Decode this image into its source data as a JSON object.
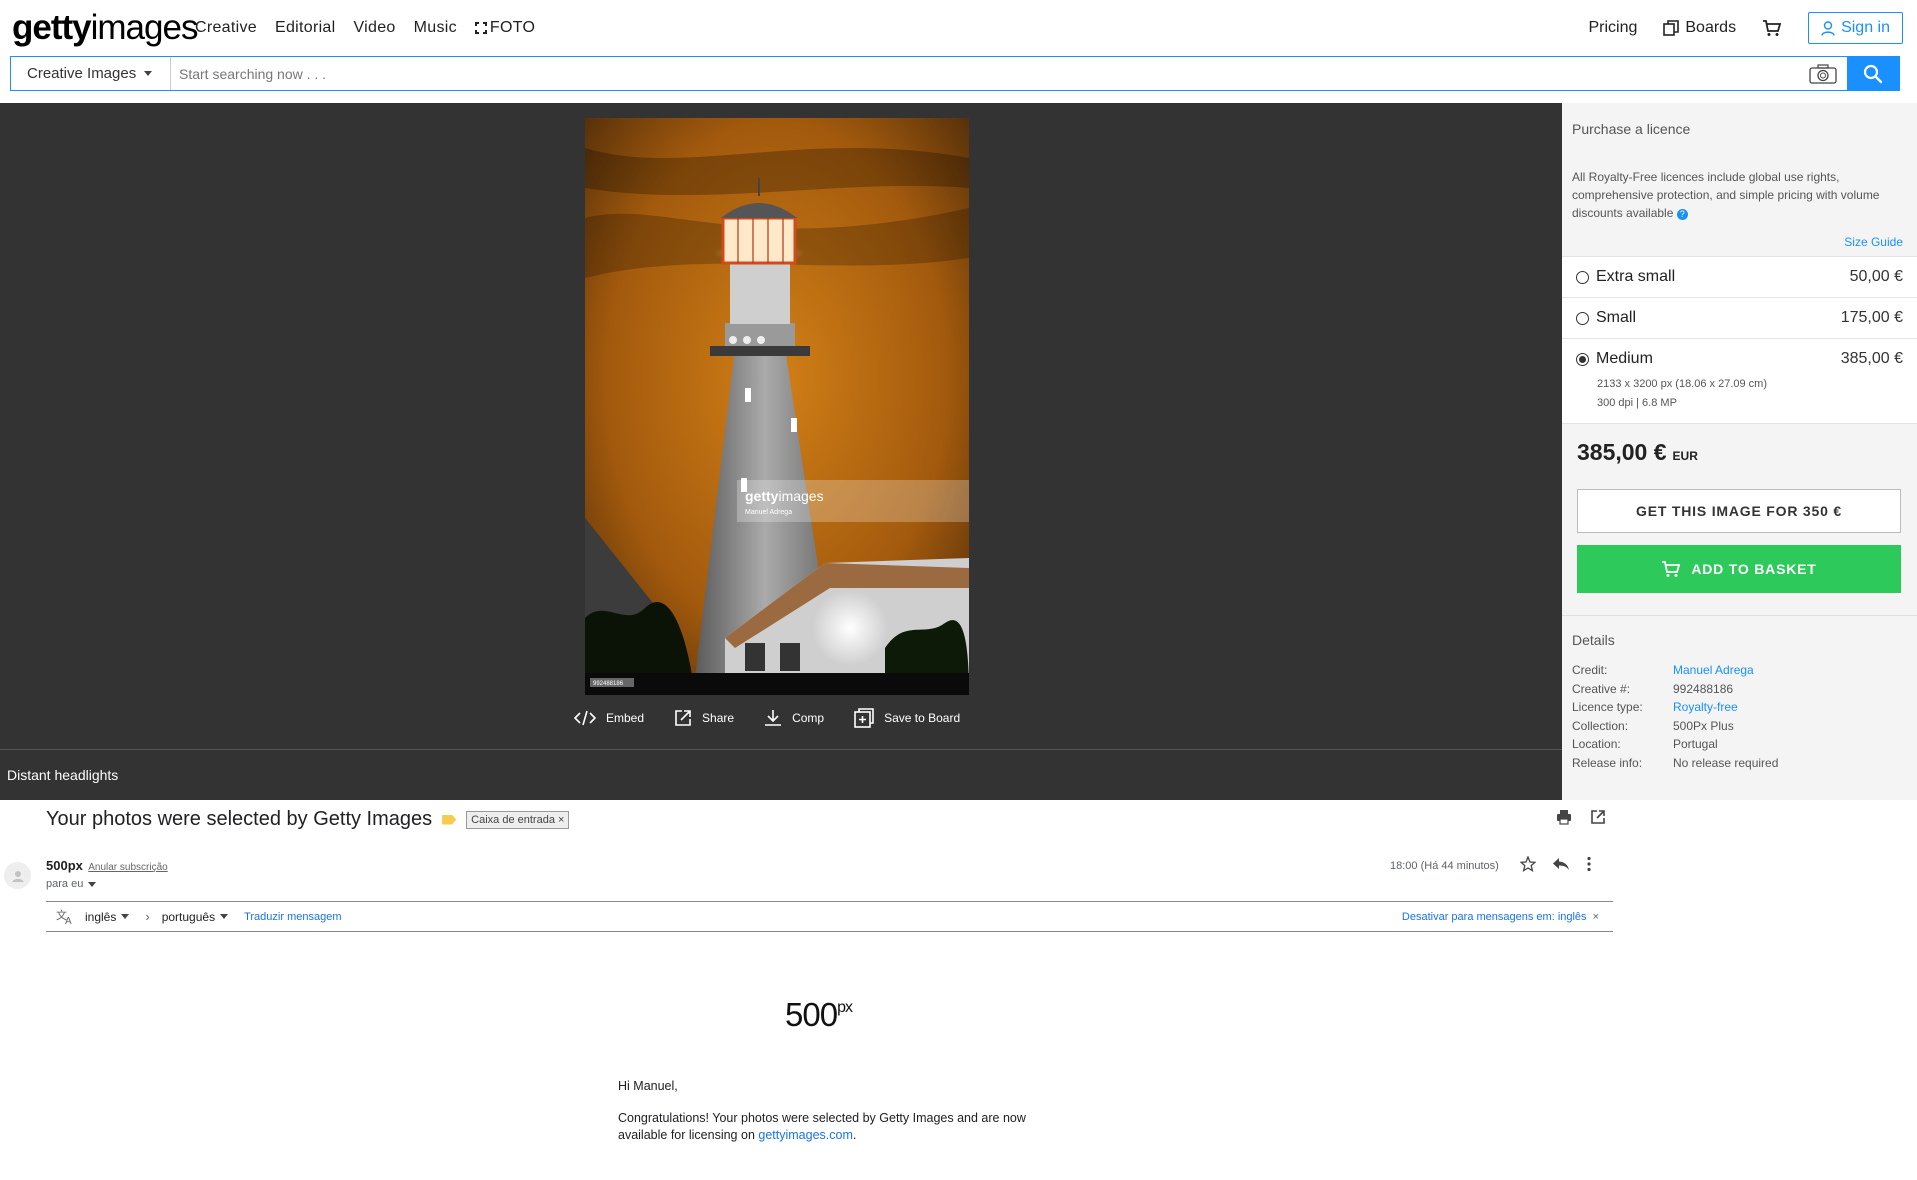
{
  "nav": {
    "logo_bold": "getty",
    "logo_light": "images",
    "links": [
      "Creative",
      "Editorial",
      "Video",
      "Music"
    ],
    "foto_label": "FOTO",
    "pricing": "Pricing",
    "boards": "Boards",
    "signin": "Sign in"
  },
  "search": {
    "category": "Creative Images",
    "placeholder": "Start searching now . . ."
  },
  "photo": {
    "watermark_bold": "getty",
    "watermark_light": "images",
    "watermark_credit": "Manuel Adrega",
    "id_tag": "992488186",
    "caption": "Distant headlights",
    "actions": [
      "Embed",
      "Share",
      "Comp",
      "Save to Board"
    ]
  },
  "purchase": {
    "title": "Purchase a licence",
    "description": "All Royalty-Free licences include global use rights, comprehensive protection, and simple pricing with volume discounts available",
    "size_guide": "Size Guide",
    "sizes": [
      {
        "name": "Extra small",
        "price": "50,00 €",
        "selected": false
      },
      {
        "name": "Small",
        "price": "175,00 €",
        "selected": false
      },
      {
        "name": "Medium",
        "price": "385,00 €",
        "selected": true,
        "dims": "2133 x 3200 px (18.06 x 27.09 cm)",
        "res": "300 dpi | 6.8 MP"
      }
    ],
    "total": "385,00 €",
    "currency": "EUR",
    "get_image_label": "GET THIS IMAGE FOR 350 €",
    "add_basket_label": "ADD TO BASKET"
  },
  "details": {
    "title": "Details",
    "rows": [
      {
        "label": "Credit:",
        "value": "Manuel Adrega",
        "link": true
      },
      {
        "label": "Creative #:",
        "value": "992488186",
        "link": false
      },
      {
        "label": "Licence type:",
        "value": "Royalty-free",
        "link": true
      },
      {
        "label": "Collection:",
        "value": "500Px Plus",
        "link": false
      },
      {
        "label": "Location:",
        "value": "Portugal",
        "link": false
      },
      {
        "label": "Release info:",
        "value": "No release required",
        "link": false
      }
    ]
  },
  "email": {
    "subject": "Your photos were selected by Getty Images",
    "inbox_chip": "Caixa de entrada ×",
    "sender": "500px",
    "unsubscribe": "Anular subscrição",
    "to": "para eu",
    "time": "18:00 (Há 44 minutos)",
    "lang_from": "inglês",
    "lang_to": "português",
    "translate": "Traduzir mensagem",
    "disable_translate": "Desativar para mensagens em: inglês",
    "brand": "500",
    "brand_sup": "px",
    "greeting": "Hi Manuel,",
    "body_text": "Congratulations! Your photos were selected by Getty Images and are now available for licensing on ",
    "body_link": "gettyimages.com",
    "body_end": "."
  },
  "colors": {
    "accent": "#1a90ff",
    "basket_green": "#2dca5b",
    "dark_bg": "#333333"
  }
}
